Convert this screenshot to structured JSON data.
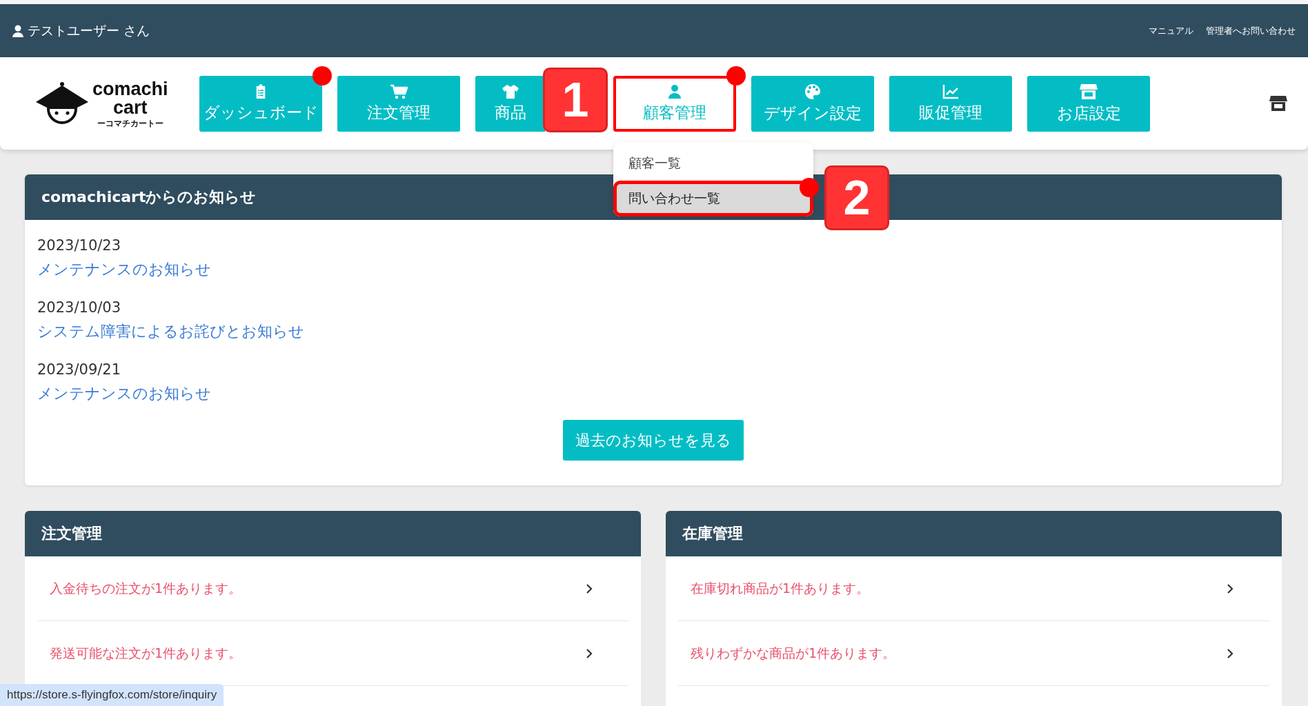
{
  "header": {
    "user_name": "テストユーザー さん",
    "links": [
      "マニュアル",
      "管理者へお問い合わせ"
    ]
  },
  "logo": {
    "line_1": "comachi",
    "line_2": "cart",
    "tagline": "ーコマチカートー"
  },
  "nav": [
    {
      "label": "ダッシュボード",
      "marker": true,
      "highlighted": false
    },
    {
      "label": "注文管理",
      "marker": false,
      "highlighted": false
    },
    {
      "label": "商品",
      "marker": false,
      "highlighted": false
    },
    {
      "label": "顧客管理",
      "marker": true,
      "highlighted": true,
      "callout": "1",
      "dropdown": [
        {
          "label": "顧客一覧",
          "hovered": false,
          "highlighted": false,
          "marker": false
        },
        {
          "label": "問い合わせ一覧",
          "hovered": true,
          "highlighted": true,
          "marker": true,
          "callout": "2"
        }
      ]
    },
    {
      "label": "デザイン設定",
      "marker": false,
      "highlighted": false
    },
    {
      "label": "販促管理",
      "marker": false,
      "highlighted": false
    },
    {
      "label": "お店設定",
      "marker": false,
      "highlighted": false
    }
  ],
  "notices": {
    "title": "comachicartからのお知らせ",
    "items": [
      {
        "date": "2023/10/23",
        "title": "メンテナンスのお知らせ"
      },
      {
        "date": "2023/10/03",
        "title": "システム障害によるお詫びとお知らせ"
      },
      {
        "date": "2023/09/21",
        "title": "メンテナンスのお知らせ"
      }
    ],
    "button": "過去のお知らせを見る"
  },
  "panels": [
    {
      "title": "注文管理",
      "rows": [
        "入金待ちの注文が1件あります。",
        "発送可能な注文が1件あります。"
      ]
    },
    {
      "title": "在庫管理",
      "rows": [
        "在庫切れ商品が1件あります。",
        "残りわずかな商品が1件あります。"
      ]
    }
  ],
  "status_url": "https://store.s-flyingfox.com/store/inquiry"
}
